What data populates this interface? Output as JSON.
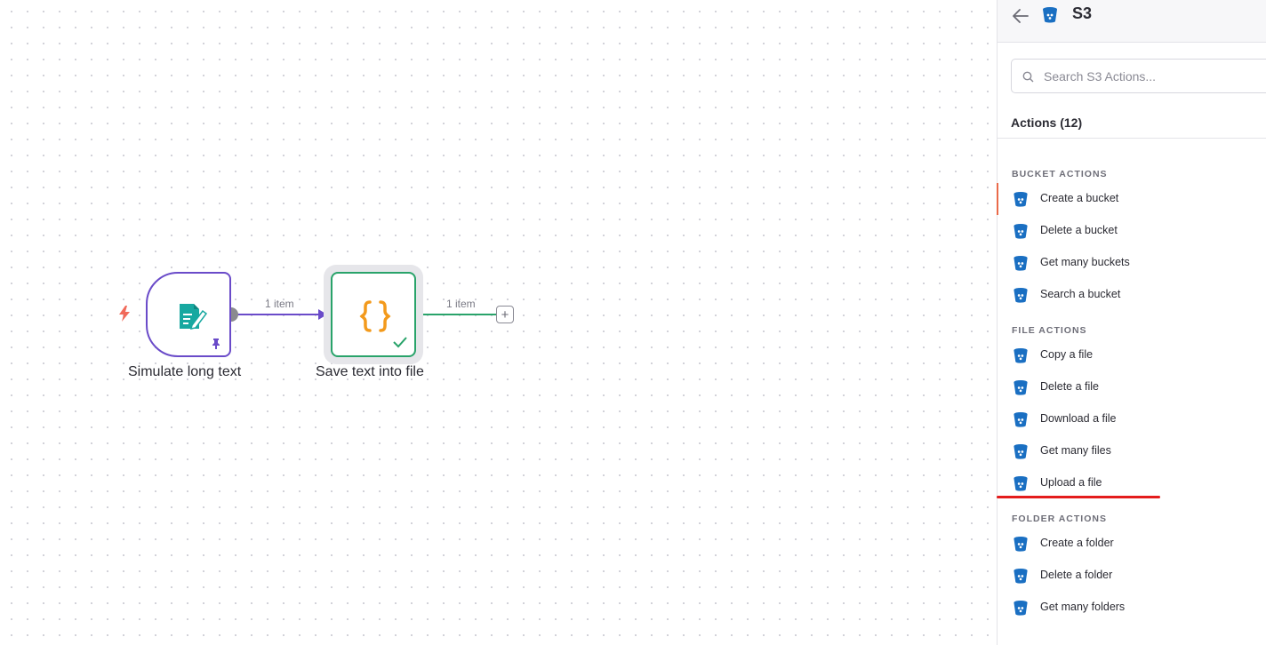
{
  "canvas": {
    "nodes": [
      {
        "id": "simulate",
        "label": "Simulate long text",
        "icon": "edit-document-icon"
      },
      {
        "id": "save",
        "label": "Save text into file",
        "icon": "code-braces-icon"
      }
    ],
    "connections": [
      {
        "label": "1 item"
      },
      {
        "label": "1 item"
      }
    ],
    "add_button": "+"
  },
  "panel": {
    "title": "S3",
    "search": {
      "placeholder": "Search S3 Actions...",
      "value": ""
    },
    "actions_count": "Actions (12)",
    "sections": [
      {
        "title": "BUCKET ACTIONS",
        "items": [
          "Create a bucket",
          "Delete a bucket",
          "Get many buckets",
          "Search a bucket"
        ]
      },
      {
        "title": "FILE ACTIONS",
        "items": [
          "Copy a file",
          "Delete a file",
          "Download a file",
          "Get many files",
          "Upload a file"
        ]
      },
      {
        "title": "FOLDER ACTIONS",
        "items": [
          "Create a folder",
          "Delete a folder",
          "Get many folders"
        ]
      }
    ]
  },
  "colors": {
    "accent_purple": "#6a4bc9",
    "success_green": "#29a36a",
    "bucket_blue": "#1a6fc2",
    "highlight_red": "#e41c1c"
  }
}
